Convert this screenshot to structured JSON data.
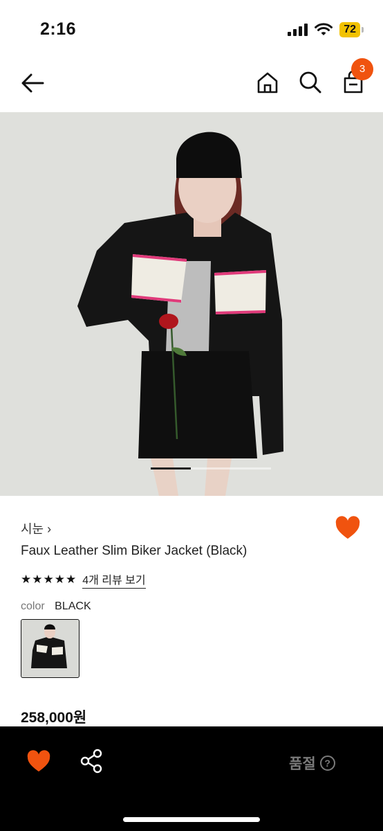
{
  "status": {
    "time": "2:16",
    "battery": "72"
  },
  "nav": {
    "cart_count": "3"
  },
  "gallery": {
    "image_count": 3,
    "active_index": 0
  },
  "product": {
    "brand": "시눈 ›",
    "name": "Faux Leather Slim Biker Jacket (Black)",
    "rating": {
      "stars": "★★★★★",
      "value": 5,
      "review_link": "4개 리뷰 보기"
    },
    "color_label": "color",
    "color_value": "BLACK",
    "price": "258,000원"
  },
  "bottom_bar": {
    "status_label": "품절",
    "help_glyph": "?"
  },
  "colors": {
    "accent": "#f0530f",
    "bottom_bar_bg": "#000000",
    "soldout_text": "#7a7a7a",
    "battery": "#f2c200"
  },
  "icons": [
    "back-arrow-icon",
    "home-icon",
    "search-icon",
    "shopping-bag-icon",
    "heart-icon",
    "share-icon",
    "help-icon"
  ]
}
